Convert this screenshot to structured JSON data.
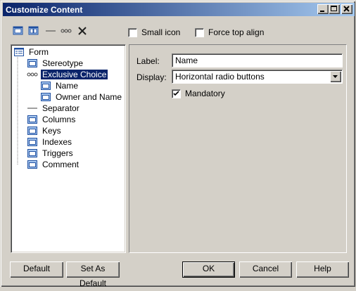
{
  "window": {
    "title": "Customize Content"
  },
  "toolbar": {
    "icons": [
      "add-attribute-icon",
      "add-group-icon",
      "separator-icon",
      "exclusive-choice-icon",
      "delete-icon"
    ],
    "small_icon_label": "Small icon",
    "small_icon_checked": false,
    "force_top_align_label": "Force top align",
    "force_top_align_checked": false
  },
  "tree": {
    "root": "Form",
    "items": [
      {
        "label": "Stereotype",
        "icon": "attribute-icon"
      },
      {
        "label": "Exclusive Choice",
        "icon": "exclusive-choice-icon",
        "selected": true
      },
      {
        "label": "Name",
        "icon": "attribute-icon"
      },
      {
        "label": "Owner and Name",
        "icon": "attribute-icon"
      },
      {
        "label": "Separator",
        "icon": "separator-icon"
      },
      {
        "label": "Columns",
        "icon": "attribute-icon"
      },
      {
        "label": "Keys",
        "icon": "attribute-icon"
      },
      {
        "label": "Indexes",
        "icon": "attribute-icon"
      },
      {
        "label": "Triggers",
        "icon": "attribute-icon"
      },
      {
        "label": "Comment",
        "icon": "attribute-icon"
      }
    ]
  },
  "properties": {
    "label_caption": "Label:",
    "label_value": "Name",
    "display_caption": "Display:",
    "display_value": "Horizontal radio buttons",
    "mandatory_label": "Mandatory",
    "mandatory_checked": true
  },
  "buttons": {
    "default": "Default",
    "set_as_default": "Set As Default",
    "ok": "OK",
    "cancel": "Cancel",
    "help": "Help"
  },
  "colors": {
    "title_bar_start": "#0a246a",
    "title_bar_end": "#a6caf0",
    "face": "#d4d0c8",
    "selection": "#0a246a"
  }
}
